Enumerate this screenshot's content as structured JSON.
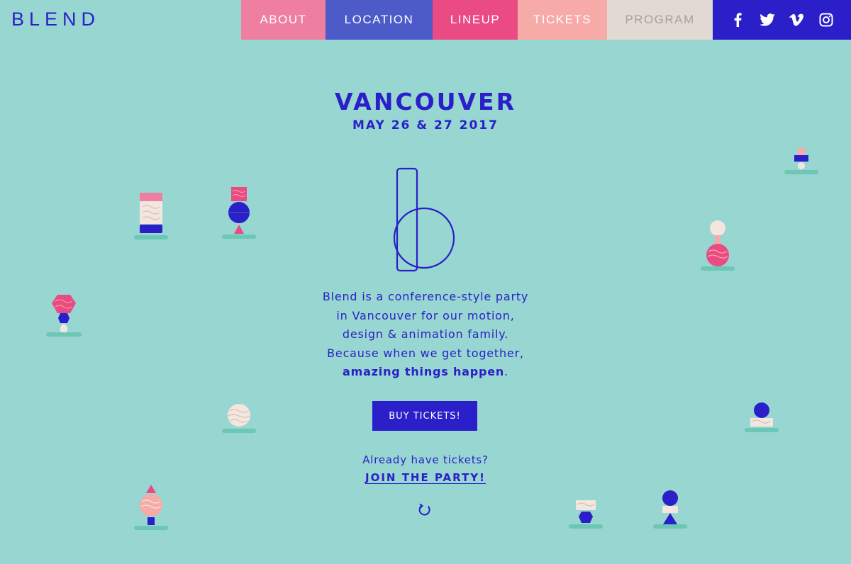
{
  "logo": "BLEND",
  "nav": {
    "items": [
      {
        "label": "ABOUT"
      },
      {
        "label": "LOCATION"
      },
      {
        "label": "LINEUP"
      },
      {
        "label": "TICKETS"
      },
      {
        "label": "PROGRAM"
      }
    ]
  },
  "social": [
    "facebook-icon",
    "twitter-icon",
    "vimeo-icon",
    "instagram-icon"
  ],
  "hero": {
    "city": "VANCOUVER",
    "date": "MAY 26 & 27 2017"
  },
  "intro": {
    "line1": "Blend is a conference-style party",
    "line2": "in Vancouver for our motion,",
    "line3": "design & animation family.",
    "line4": "Because when we get together,",
    "emphasis": "amazing things happen",
    "end": "."
  },
  "cta": {
    "buy": "BUY TICKETS!",
    "already": "Already have tickets?",
    "join": "JOIN THE PARTY!"
  },
  "colors": {
    "background": "#97d6d1",
    "brand_blue": "#2a1fc8",
    "pink": "#ea4b82",
    "light_pink": "#f7aba8",
    "cream": "#f3e6df"
  }
}
